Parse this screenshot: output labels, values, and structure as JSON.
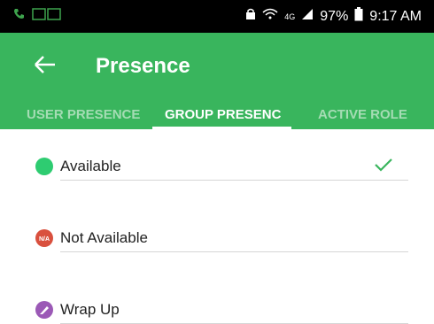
{
  "status_bar": {
    "battery": "97%",
    "time": "9:17 AM",
    "network": "4G"
  },
  "app_bar": {
    "title": "Presence"
  },
  "tabs": [
    {
      "label": "USER PRESENCE",
      "selected": false
    },
    {
      "label": "GROUP PRESENC",
      "selected": true
    },
    {
      "label": "ACTIVE ROLE",
      "selected": false
    }
  ],
  "presence_items": [
    {
      "label": "Available",
      "icon": "available-dot-icon",
      "color": "#2ecc71",
      "selected": true
    },
    {
      "label": "Not Available",
      "icon": "not-available-icon",
      "badge": "N/A",
      "color": "#d9503e",
      "selected": false
    },
    {
      "label": "Wrap Up",
      "icon": "wrap-up-icon",
      "color": "#9b59b6",
      "selected": false
    }
  ],
  "colors": {
    "primary": "#39b55d",
    "check": "#39b55d"
  }
}
